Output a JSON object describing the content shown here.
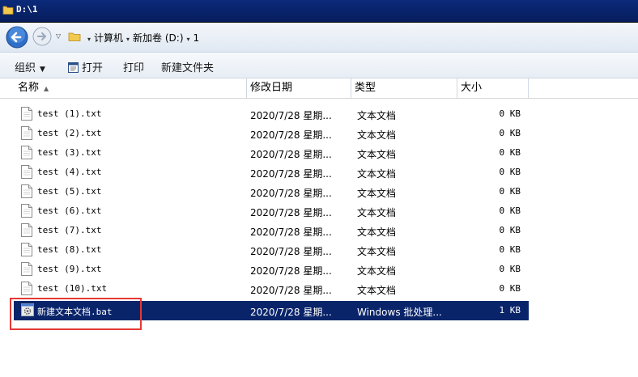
{
  "window": {
    "title": "D:\\1"
  },
  "address": {
    "crumbs": [
      "计算机",
      "新加卷 (D:)",
      "1"
    ]
  },
  "toolbar": {
    "organize": "组织",
    "open": "打开",
    "print": "打印",
    "new_folder": "新建文件夹"
  },
  "columns": {
    "name": "名称",
    "date": "修改日期",
    "type": "类型",
    "size": "大小"
  },
  "files": [
    {
      "name": "test (1).txt",
      "date": "2020/7/28 星期...",
      "type": "文本文档",
      "size": "0 KB"
    },
    {
      "name": "test (2).txt",
      "date": "2020/7/28 星期...",
      "type": "文本文档",
      "size": "0 KB"
    },
    {
      "name": "test (3).txt",
      "date": "2020/7/28 星期...",
      "type": "文本文档",
      "size": "0 KB"
    },
    {
      "name": "test (4).txt",
      "date": "2020/7/28 星期...",
      "type": "文本文档",
      "size": "0 KB"
    },
    {
      "name": "test (5).txt",
      "date": "2020/7/28 星期...",
      "type": "文本文档",
      "size": "0 KB"
    },
    {
      "name": "test (6).txt",
      "date": "2020/7/28 星期...",
      "type": "文本文档",
      "size": "0 KB"
    },
    {
      "name": "test (7).txt",
      "date": "2020/7/28 星期...",
      "type": "文本文档",
      "size": "0 KB"
    },
    {
      "name": "test (8).txt",
      "date": "2020/7/28 星期...",
      "type": "文本文档",
      "size": "0 KB"
    },
    {
      "name": "test (9).txt",
      "date": "2020/7/28 星期...",
      "type": "文本文档",
      "size": "0 KB"
    },
    {
      "name": "test (10).txt",
      "date": "2020/7/28 星期...",
      "type": "文本文档",
      "size": "0 KB"
    },
    {
      "name": "新建文本文档.bat",
      "date": "2020/7/28 星期...",
      "type": "Windows 批处理...",
      "size": "1 KB"
    }
  ],
  "icons": {
    "txt": "text-file-icon",
    "bat": "batch-file-icon"
  },
  "colors": {
    "selection": "#0a246a",
    "highlight_box": "#e53935"
  }
}
